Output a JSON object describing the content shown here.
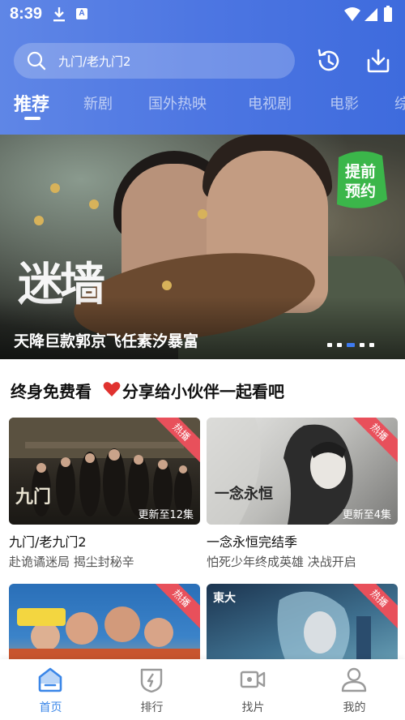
{
  "status_bar": {
    "time": "8:39",
    "a_badge": "A"
  },
  "search": {
    "placeholder_text": "九门/老九门2"
  },
  "tabs": [
    {
      "label": "推荐",
      "active": true
    },
    {
      "label": "新剧"
    },
    {
      "label": "国外热映"
    },
    {
      "label": "电视剧"
    },
    {
      "label": "电影"
    },
    {
      "label": "综"
    }
  ],
  "banner": {
    "title_art": "迷墙",
    "badge_line1": "提前",
    "badge_line2": "预约",
    "caption": "天降巨款郭京飞任素汐暴富",
    "dot_count": 5,
    "active_dot": 2
  },
  "section": {
    "title_part1": "终身免费看",
    "title_part2": "分享给小伙伴一起看吧"
  },
  "cards": [
    {
      "badge": "热播",
      "update": "更新至12集",
      "title": "九门/老九门2",
      "subtitle": "赴诡谲迷局 揭尘封秘辛",
      "poster_art": "九门"
    },
    {
      "badge": "热播",
      "update": "更新至4集",
      "title": "一念永恒完结季",
      "subtitle": "怕死少年终成英雄 决战开启",
      "poster_art": "一念永恒"
    },
    {
      "badge": "热播",
      "update": "",
      "title": "",
      "subtitle": "",
      "poster_art": ""
    },
    {
      "badge": "热播",
      "update": "",
      "title": "",
      "subtitle": "",
      "poster_art": "東大"
    }
  ],
  "bottom_nav": [
    {
      "label": "首页",
      "icon": "home-icon",
      "active": true
    },
    {
      "label": "排行",
      "icon": "ranking-icon"
    },
    {
      "label": "找片",
      "icon": "video-camera-icon"
    },
    {
      "label": "我的",
      "icon": "person-icon"
    }
  ],
  "colors": {
    "accent": "#3a86e8",
    "header": "#4d76e2",
    "hot": "#e8505b"
  }
}
